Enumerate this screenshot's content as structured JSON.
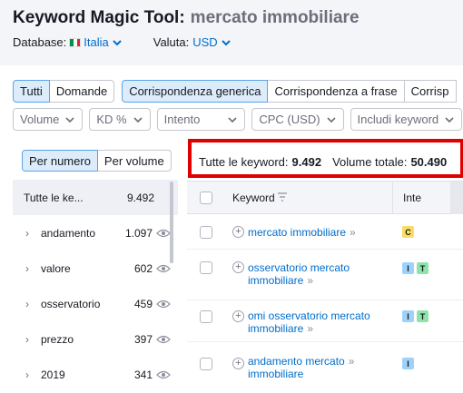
{
  "header": {
    "title": "Keyword Magic Tool:",
    "query": "mercato immobiliare",
    "database_label": "Database:",
    "database_value": "Italia",
    "currency_label": "Valuta:",
    "currency_value": "USD"
  },
  "match_tabs": [
    "Tutti",
    "Domande"
  ],
  "type_tabs": [
    "Corrispondenza generica",
    "Corrispondenza a frase",
    "Corrisp"
  ],
  "filters": [
    "Volume",
    "KD %",
    "Intento",
    "CPC (USD)",
    "Includi keyword"
  ],
  "left_panel": {
    "toggle": [
      "Per numero",
      "Per volume"
    ],
    "all_label": "Tutte le ke...",
    "all_count": "9.492",
    "groups": [
      {
        "name": "andamento",
        "count": "1.097"
      },
      {
        "name": "valore",
        "count": "602"
      },
      {
        "name": "osservatorio",
        "count": "459"
      },
      {
        "name": "prezzo",
        "count": "397"
      },
      {
        "name": "2019",
        "count": "341"
      }
    ]
  },
  "summary": {
    "keywords_label": "Tutte le keyword:",
    "keywords_value": "9.492",
    "volume_label": "Volume totale:",
    "volume_value": "50.490"
  },
  "table": {
    "col_keyword": "Keyword",
    "col_intent": "Inte",
    "rows": [
      {
        "keyword": [
          "mercato immobiliare"
        ],
        "intents": [
          "C"
        ]
      },
      {
        "keyword": [
          "osservatorio mercato",
          "immobiliare"
        ],
        "intents": [
          "I",
          "T"
        ]
      },
      {
        "keyword": [
          "omi osservatorio mercato",
          "immobiliare"
        ],
        "intents": [
          "I",
          "T"
        ]
      },
      {
        "keyword": [
          "andamento mercato",
          "immobiliare"
        ],
        "intents": [
          "I"
        ]
      }
    ]
  },
  "colors": {
    "accent": "#006dca",
    "active_tab_bg": "#dcecfb",
    "highlight": "#e00000",
    "commercial": "#fcdc63",
    "informational": "#9ed2fa",
    "transactional": "#8de3a8"
  }
}
